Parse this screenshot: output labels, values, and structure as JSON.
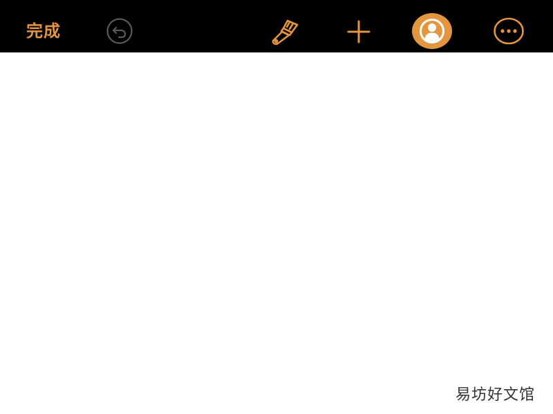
{
  "toolbar": {
    "done_label": "完成",
    "icons": {
      "undo": "undo-icon",
      "brush": "paintbrush-icon",
      "add": "plus-icon",
      "collaborate": "collaborate-person-icon",
      "more": "more-ellipsis-icon"
    },
    "accent_color": "#e3953f",
    "disabled_color": "#5a5a5a",
    "background_color": "#000000"
  },
  "document": {
    "background_color": "#ffffff"
  },
  "watermark": {
    "text": "易坊好文馆"
  }
}
